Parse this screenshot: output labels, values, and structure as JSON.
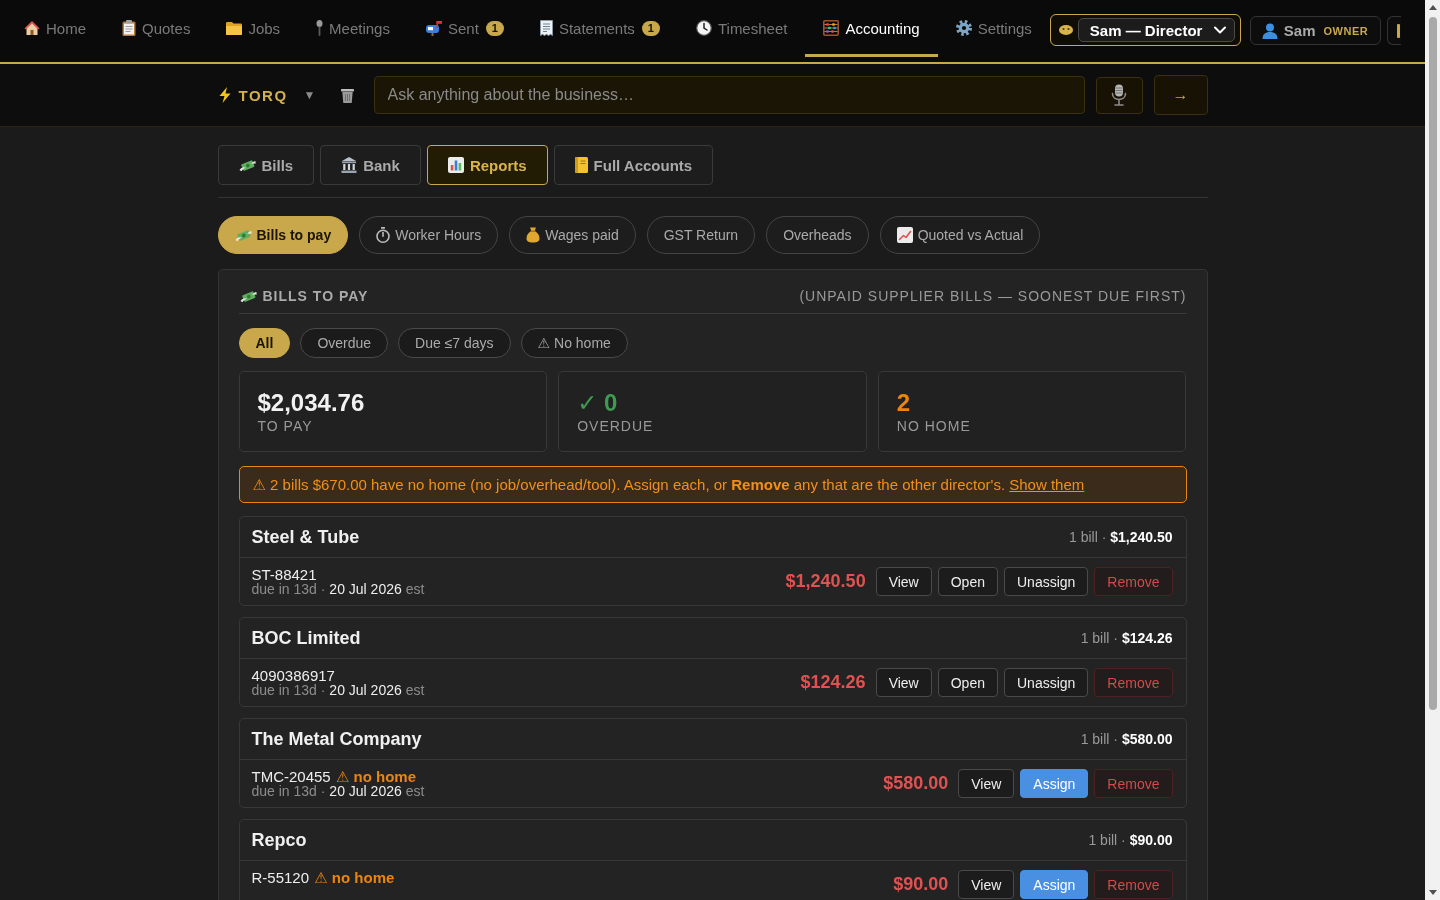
{
  "nav": {
    "items": [
      {
        "label": "Home",
        "selected": false
      },
      {
        "label": "Quotes",
        "selected": false
      },
      {
        "label": "Jobs",
        "selected": false
      },
      {
        "label": "Meetings",
        "selected": false
      },
      {
        "label": "Sent",
        "selected": false,
        "badge": "1"
      },
      {
        "label": "Statements",
        "selected": false,
        "badge": "1"
      },
      {
        "label": "Timesheet",
        "selected": false
      },
      {
        "label": "Accounting",
        "selected": true
      },
      {
        "label": "Settings",
        "selected": false
      }
    ],
    "role": {
      "value": "Sam — Director"
    },
    "user": {
      "name": "Sam",
      "role": "OWNER"
    }
  },
  "assistant": {
    "brand": "TORQ",
    "menu": "▼",
    "placeholder": "Ask anything about the business…",
    "send": "→"
  },
  "tabs": [
    {
      "label": "Bills",
      "selected": false
    },
    {
      "label": "Bank",
      "selected": false
    },
    {
      "label": "Reports",
      "selected": true
    },
    {
      "label": "Full Accounts",
      "selected": false
    }
  ],
  "reports": [
    {
      "label": "Bills to pay",
      "selected": true
    },
    {
      "label": "Worker Hours",
      "selected": false
    },
    {
      "label": "Wages paid",
      "selected": false
    },
    {
      "label": "GST Return",
      "selected": false
    },
    {
      "label": "Overheads",
      "selected": false
    },
    {
      "label": "Quoted vs Actual",
      "selected": false
    }
  ],
  "bills_panel": {
    "title": "BILLS TO PAY",
    "subtitle": "(UNPAID SUPPLIER BILLS — SOONEST DUE FIRST)",
    "filters": [
      {
        "label": "All",
        "selected": true
      },
      {
        "label": "Overdue",
        "selected": false
      },
      {
        "label": "Due ≤7 days",
        "selected": false
      },
      {
        "label": "⚠ No home",
        "selected": false
      }
    ],
    "stats": [
      {
        "value": "$2,034.76",
        "label": "TO PAY",
        "kind": "total"
      },
      {
        "value": "✓ 0",
        "label": "OVERDUE",
        "kind": "good"
      },
      {
        "value": "2",
        "label": "NO HOME",
        "kind": "warning"
      }
    ],
    "alert": {
      "text": "⚠ 2 bills $670.00 have no home (no job/overhead/tool). Assign each, or **Remove** any that are the other director's.",
      "link": "Show them"
    },
    "suppliers": [
      {
        "name": "Steel & Tube",
        "summary": "1 bill · **$1,240.50**",
        "bills": [
          {
            "ref": "ST-88421",
            "due": "due in 13d · **20 Jul 2026** est",
            "amount": "$1,240.50",
            "actions": [
              {
                "label": "View",
                "kind": "default"
              },
              {
                "label": "Open",
                "kind": "default"
              },
              {
                "label": "Unassign",
                "kind": "default"
              },
              {
                "label": "Remove",
                "kind": "danger"
              }
            ]
          }
        ]
      },
      {
        "name": "BOC Limited",
        "summary": "1 bill · **$124.26**",
        "bills": [
          {
            "ref": "4090386917",
            "due": "due in 13d · **20 Jul 2026** est",
            "amount": "$124.26",
            "actions": [
              {
                "label": "View",
                "kind": "default"
              },
              {
                "label": "Open",
                "kind": "default"
              },
              {
                "label": "Unassign",
                "kind": "default"
              },
              {
                "label": "Remove",
                "kind": "danger"
              }
            ]
          }
        ]
      },
      {
        "name": "The Metal Company",
        "summary": "1 bill · **$580.00**",
        "bills": [
          {
            "ref": "TMC-20455",
            "flag": "⚠ no home",
            "due": "due in 13d · **20 Jul 2026** est",
            "amount": "$580.00",
            "actions": [
              {
                "label": "View",
                "kind": "default"
              },
              {
                "label": "Assign",
                "kind": "primary"
              },
              {
                "label": "Remove",
                "kind": "danger"
              }
            ]
          }
        ]
      },
      {
        "name": "Repco",
        "summary": "1 bill · **$90.00**",
        "bills": [
          {
            "ref": "R-55120",
            "flag": "⚠ no home",
            "amount": "$90.00",
            "actions": [
              {
                "label": "View",
                "kind": "default"
              },
              {
                "label": "Assign",
                "kind": "primary"
              },
              {
                "label": "Remove",
                "kind": "danger"
              }
            ]
          }
        ]
      }
    ]
  }
}
